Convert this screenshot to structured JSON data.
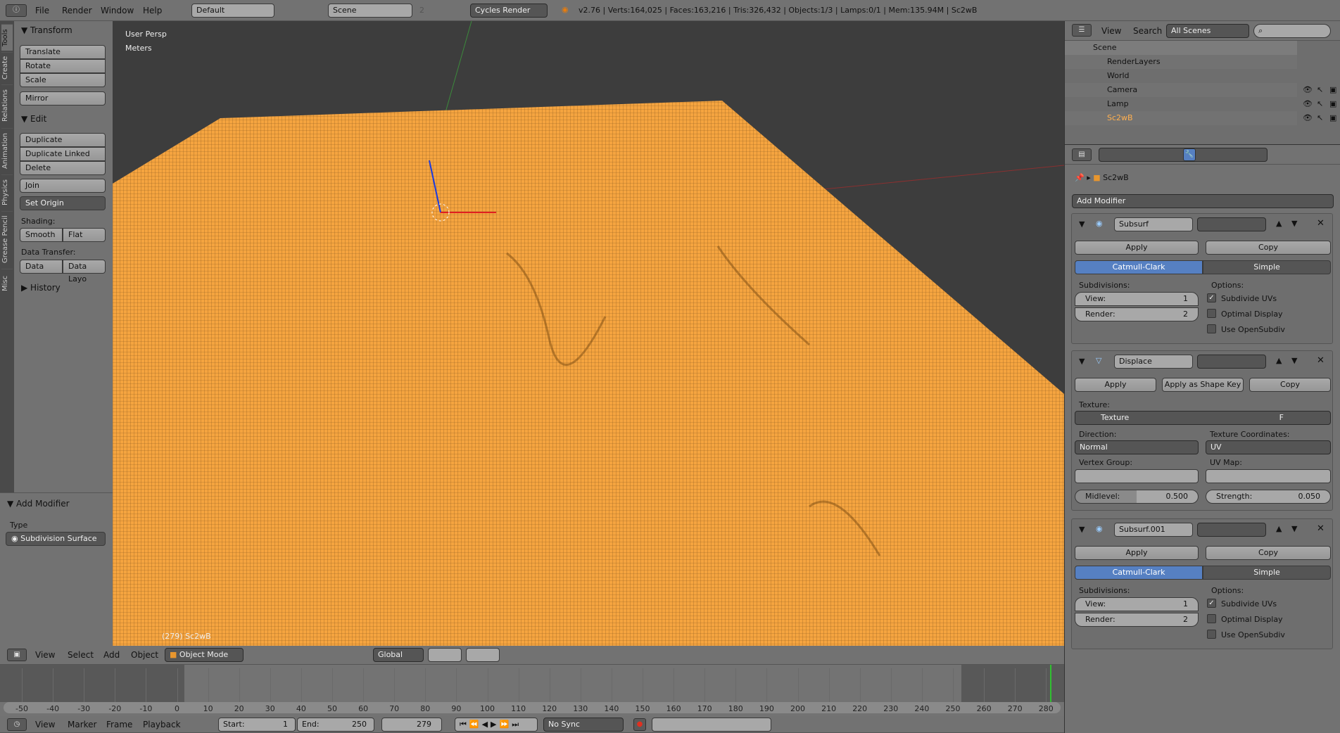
{
  "topbar": {
    "menus": [
      "File",
      "Render",
      "Window",
      "Help"
    ],
    "layout": "Default",
    "scene": "Scene",
    "scene_users": "2",
    "engine": "Cycles Render",
    "stats": "v2.76 | Verts:164,025 | Faces:163,216 | Tris:326,432 | Objects:1/3 | Lamps:0/1 | Mem:135.94M | Sc2wB"
  },
  "toolshelf": {
    "tabs": [
      "Tools",
      "Create",
      "Relations",
      "Animation",
      "Physics",
      "Grease Pencil",
      "Misc"
    ],
    "transform": {
      "title": "Transform",
      "buttons": [
        "Translate",
        "Rotate",
        "Scale",
        "Mirror"
      ]
    },
    "edit": {
      "title": "Edit",
      "buttons": [
        "Duplicate",
        "Duplicate Linked",
        "Delete",
        "Join"
      ],
      "set_origin": "Set Origin",
      "shading_label": "Shading:",
      "smooth": "Smooth",
      "flat": "Flat",
      "data_transfer_label": "Data Transfer:",
      "data": "Data",
      "data_layout": "Data Layo"
    },
    "history": "History",
    "operator": {
      "title": "Add Modifier",
      "type_label": "Type",
      "type_value": "Subdivision Surface"
    }
  },
  "viewport": {
    "view_name": "User Persp",
    "units": "Meters",
    "object_info": "(279) Sc2wB",
    "mesh_color": "#f5a440"
  },
  "view3d_header": {
    "menus": [
      "View",
      "Select",
      "Add",
      "Object"
    ],
    "mode": "Object Mode",
    "orientation": "Global"
  },
  "timeline": {
    "ticks": [
      "-50",
      "-40",
      "-30",
      "-20",
      "-10",
      "0",
      "10",
      "20",
      "30",
      "40",
      "50",
      "60",
      "70",
      "80",
      "90",
      "100",
      "110",
      "120",
      "130",
      "140",
      "150",
      "160",
      "170",
      "180",
      "190",
      "200",
      "210",
      "220",
      "230",
      "240",
      "250",
      "260",
      "270",
      "280"
    ],
    "menus": [
      "View",
      "Marker",
      "Frame",
      "Playback"
    ],
    "start_label": "Start:",
    "start": "1",
    "end_label": "End:",
    "end": "250",
    "current": "279",
    "sync": "No Sync"
  },
  "outliner": {
    "menus": [
      "View",
      "Search"
    ],
    "filter": "All Scenes",
    "items": [
      {
        "name": "Scene",
        "level": 0
      },
      {
        "name": "RenderLayers",
        "level": 1
      },
      {
        "name": "World",
        "level": 1
      },
      {
        "name": "Camera",
        "level": 1
      },
      {
        "name": "Lamp",
        "level": 1
      },
      {
        "name": "Sc2wB",
        "level": 1
      }
    ]
  },
  "properties": {
    "breadcrumb": "Sc2wB",
    "add_modifier": "Add Modifier",
    "subsurf": {
      "name": "Subsurf",
      "apply": "Apply",
      "copy": "Copy",
      "catmull": "Catmull-Clark",
      "simple": "Simple",
      "subdivisions": "Subdivisions:",
      "view_label": "View:",
      "view": "1",
      "render_label": "Render:",
      "render": "2",
      "options": "Options:",
      "opt1": "Subdivide UVs",
      "opt2": "Optimal Display",
      "opt3": "Use OpenSubdiv"
    },
    "displace": {
      "name": "Displace",
      "apply": "Apply",
      "shape": "Apply as Shape Key",
      "copy": "Copy",
      "texture_label": "Texture:",
      "texture": "Texture",
      "texture_flag": "F",
      "direction_label": "Direction:",
      "direction": "Normal",
      "coords_label": "Texture Coordinates:",
      "coords": "UV",
      "vgroup_label": "Vertex Group:",
      "uvmap_label": "UV Map:",
      "midlevel_label": "Midlevel:",
      "midlevel": "0.500",
      "strength_label": "Strength:",
      "strength": "0.050"
    },
    "subsurf2": {
      "name": "Subsurf.001",
      "apply": "Apply",
      "copy": "Copy",
      "catmull": "Catmull-Clark",
      "simple": "Simple",
      "subdivisions": "Subdivisions:",
      "view_label": "View:",
      "view": "1",
      "render_label": "Render:",
      "render": "2",
      "options": "Options:",
      "opt1": "Subdivide UVs",
      "opt2": "Optimal Display",
      "opt3": "Use OpenSubdiv"
    }
  },
  "colors": {
    "accent": "#5680c2",
    "header": "#727272",
    "viewport": "#3d3d3d"
  }
}
